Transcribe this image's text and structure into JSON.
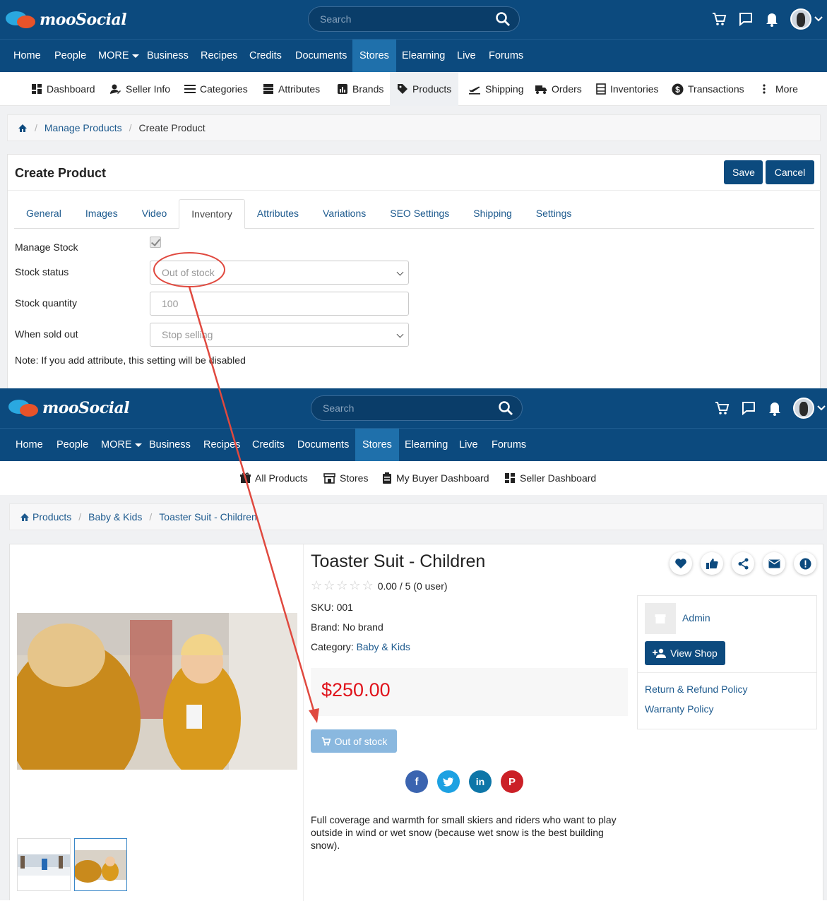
{
  "brand": {
    "name": "mooSocial"
  },
  "search": {
    "placeholder": "Search"
  },
  "nav": {
    "items": [
      "Home",
      "People",
      "MORE",
      "Business",
      "Recipes",
      "Credits",
      "Documents",
      "Stores",
      "Elearning",
      "Live",
      "Forums"
    ],
    "active": "Stores"
  },
  "seller_nav": {
    "items": [
      "Dashboard",
      "Seller Info",
      "Categories",
      "Attributes",
      "Brands",
      "Products",
      "Shipping",
      "Orders",
      "Inventories",
      "Transactions",
      "More"
    ],
    "active": "Products"
  },
  "breadcrumb_top": {
    "items": [
      "Manage Products",
      "Create Product"
    ]
  },
  "create_product": {
    "title": "Create Product",
    "save_label": "Save",
    "cancel_label": "Cancel",
    "tabs": [
      "General",
      "Images",
      "Video",
      "Inventory",
      "Attributes",
      "Variations",
      "SEO Settings",
      "Shipping",
      "Settings"
    ],
    "active_tab": "Inventory",
    "manage_stock_label": "Manage Stock",
    "manage_stock_checked": true,
    "stock_status_label": "Stock status",
    "stock_status_value": "Out of stock",
    "stock_quantity_label": "Stock quantity",
    "stock_quantity_value": "100",
    "when_sold_out_label": "When sold out",
    "when_sold_out_value": "Stop selling",
    "note": "Note: If you add attribute, this setting will be disabled"
  },
  "store_nav": {
    "items": [
      "All Products",
      "Stores",
      "My Buyer Dashboard",
      "Seller Dashboard"
    ]
  },
  "breadcrumb_bottom": {
    "items": [
      "Products",
      "Baby & Kids",
      "Toaster Suit - Children"
    ]
  },
  "product": {
    "title": "Toaster Suit - Children",
    "rating": "0.00 / 5 (0 user)",
    "sku": "SKU: 001",
    "brand": "Brand: No brand",
    "category_label": "Category:",
    "category_value": "Baby & Kids",
    "price": "$250.00",
    "cart_button": "Out of stock",
    "description": "Full coverage and warmth for small skiers and riders who want to play outside in wind or wet snow (because wet snow is the best building snow).",
    "seller_name": "Admin",
    "view_shop": "View Shop",
    "policies": [
      "Return & Refund Policy",
      "Warranty Policy"
    ]
  },
  "colors": {
    "header": "#0c4a7e",
    "active_nav": "#1f70ab",
    "price": "#e0131b",
    "annotation": "#e0493f",
    "link": "#1d5a8e"
  }
}
